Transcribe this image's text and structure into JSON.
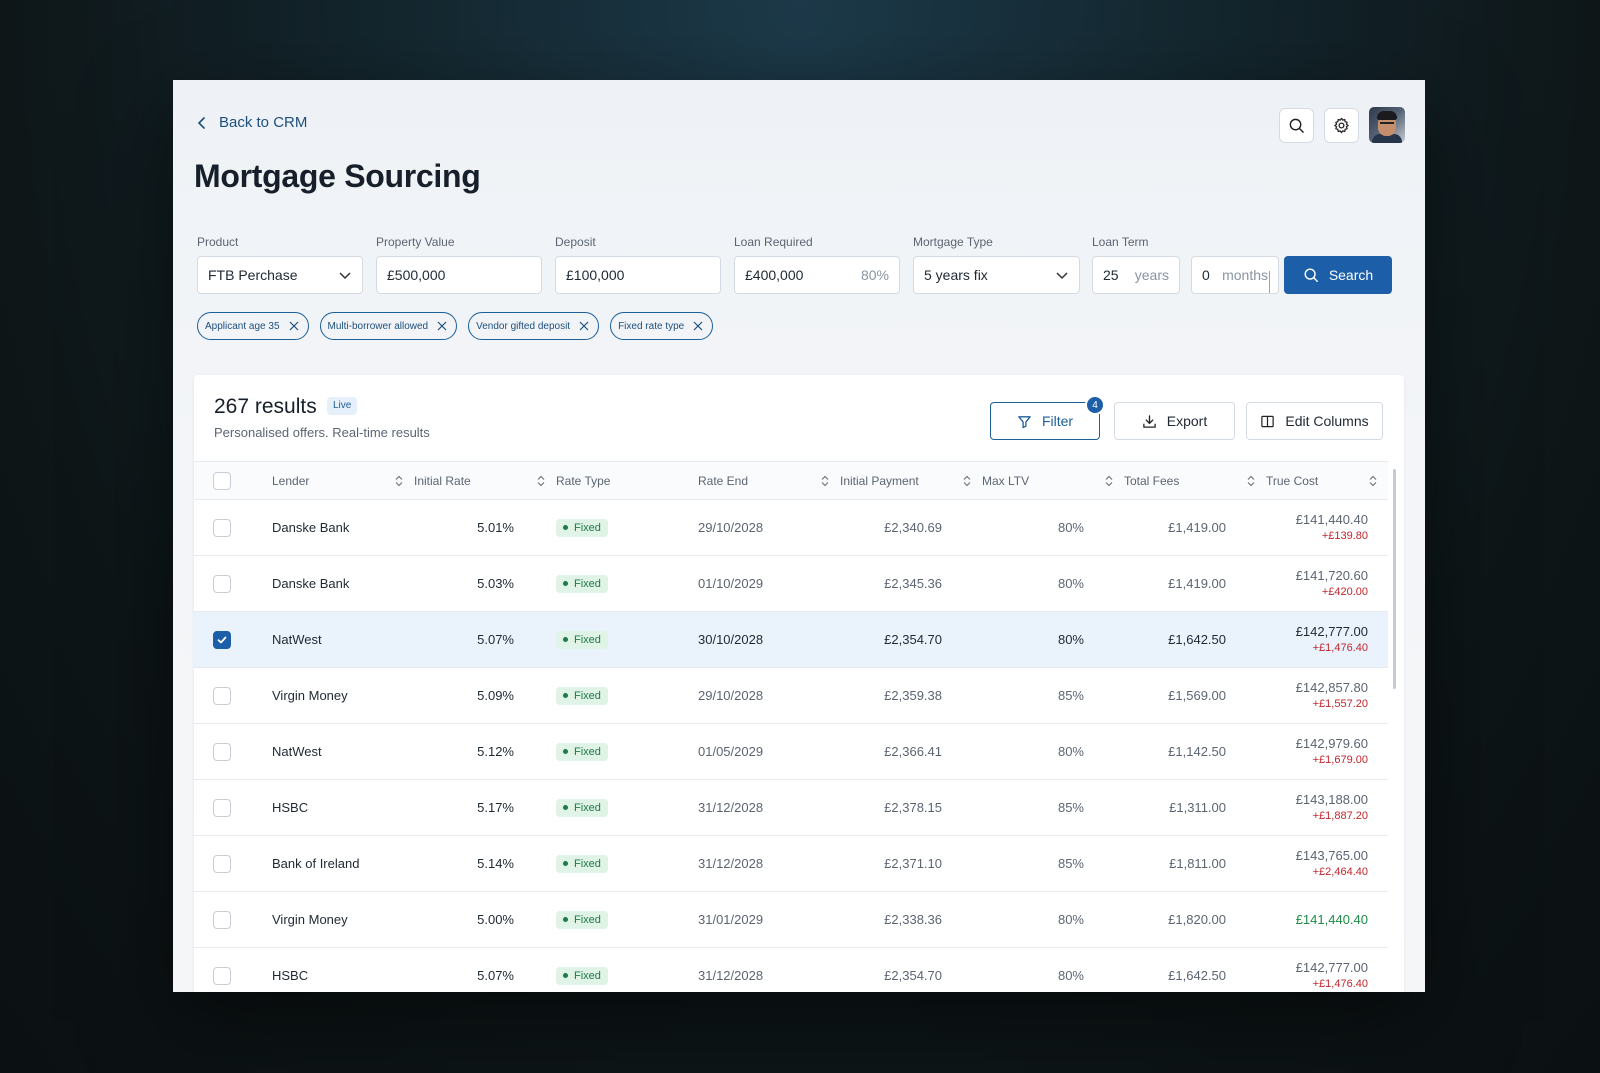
{
  "nav": {
    "back_label": "Back to CRM"
  },
  "page": {
    "title": "Mortgage Sourcing"
  },
  "form": {
    "product": {
      "label": "Product",
      "value": "FTB Perchase"
    },
    "property_value": {
      "label": "Property Value",
      "value": "£500,000"
    },
    "deposit": {
      "label": "Deposit",
      "value": "£100,000"
    },
    "loan_required": {
      "label": "Loan Required",
      "value": "£400,000",
      "ltv": "80%"
    },
    "mortgage_type": {
      "label": "Mortgage Type",
      "value": "5 years fix"
    },
    "loan_term": {
      "label": "Loan Term",
      "years": "25",
      "years_unit": "years",
      "months": "0",
      "months_unit": "months"
    },
    "search_label": "Search"
  },
  "chips": [
    {
      "label": "Applicant age 35"
    },
    {
      "label": "Multi-borrower allowed"
    },
    {
      "label": "Vendor gifted deposit"
    },
    {
      "label": "Fixed rate type"
    }
  ],
  "results": {
    "count_label": "267 results",
    "live_label": "Live",
    "subtitle": "Personalised offers. Real-time results",
    "filter_label": "Filter",
    "filter_count": "4",
    "export_label": "Export",
    "edit_columns_label": "Edit Columns",
    "columns": [
      "Lender",
      "Initial Rate",
      "Rate Type",
      "Rate End",
      "Initial Payment",
      "Max LTV",
      "Total Fees",
      "True Cost"
    ],
    "rows": [
      {
        "selected": false,
        "lender": "Danske Bank",
        "rate": "5.01%",
        "type": "Fixed",
        "end": "29/10/2028",
        "payment": "£2,340.69",
        "ltv": "80%",
        "fees": "£1,419.00",
        "cost": "£141,440.40",
        "diff": "+£139.80"
      },
      {
        "selected": false,
        "lender": "Danske Bank",
        "rate": "5.03%",
        "type": "Fixed",
        "end": "01/10/2029",
        "payment": "£2,345.36",
        "ltv": "80%",
        "fees": "£1,419.00",
        "cost": "£141,720.60",
        "diff": "+£420.00"
      },
      {
        "selected": true,
        "lender": "NatWest",
        "rate": "5.07%",
        "type": "Fixed",
        "end": "30/10/2028",
        "payment": "£2,354.70",
        "ltv": "80%",
        "fees": "£1,642.50",
        "cost": "£142,777.00",
        "diff": "+£1,476.40"
      },
      {
        "selected": false,
        "lender": "Virgin Money",
        "rate": "5.09%",
        "type": "Fixed",
        "end": "29/10/2028",
        "payment": "£2,359.38",
        "ltv": "85%",
        "fees": "£1,569.00",
        "cost": "£142,857.80",
        "diff": "+£1,557.20"
      },
      {
        "selected": false,
        "lender": "NatWest",
        "rate": "5.12%",
        "type": "Fixed",
        "end": "01/05/2029",
        "payment": "£2,366.41",
        "ltv": "80%",
        "fees": "£1,142.50",
        "cost": "£142,979.60",
        "diff": "+£1,679.00"
      },
      {
        "selected": false,
        "lender": "HSBC",
        "rate": "5.17%",
        "type": "Fixed",
        "end": "31/12/2028",
        "payment": "£2,378.15",
        "ltv": "85%",
        "fees": "£1,311.00",
        "cost": "£143,188.00",
        "diff": "+£1,887.20"
      },
      {
        "selected": false,
        "lender": "Bank of Ireland",
        "rate": "5.14%",
        "type": "Fixed",
        "end": "31/12/2028",
        "payment": "£2,371.10",
        "ltv": "85%",
        "fees": "£1,811.00",
        "cost": "£143,765.00",
        "diff": "+£2,464.40"
      },
      {
        "selected": false,
        "lender": "Virgin Money",
        "rate": "5.00%",
        "type": "Fixed",
        "end": "31/01/2029",
        "payment": "£2,338.36",
        "ltv": "80%",
        "fees": "£1,820.00",
        "cost": "£141,440.40",
        "diff": "",
        "best": true
      },
      {
        "selected": false,
        "lender": "HSBC",
        "rate": "5.07%",
        "type": "Fixed",
        "end": "31/12/2028",
        "payment": "£2,354.70",
        "ltv": "80%",
        "fees": "£1,642.50",
        "cost": "£142,777.00",
        "diff": "+£1,476.40"
      }
    ]
  },
  "colors": {
    "accent": "#1c5fa8",
    "positive": "#1e8a48",
    "negative": "#c0262d",
    "fixed_badge_bg": "#dff3e6"
  },
  "icons": [
    "chevron-left-icon",
    "search-icon",
    "gear-icon",
    "chevron-down-icon",
    "close-icon",
    "filter-icon",
    "download-icon",
    "columns-icon",
    "sort-icon",
    "check-icon"
  ]
}
